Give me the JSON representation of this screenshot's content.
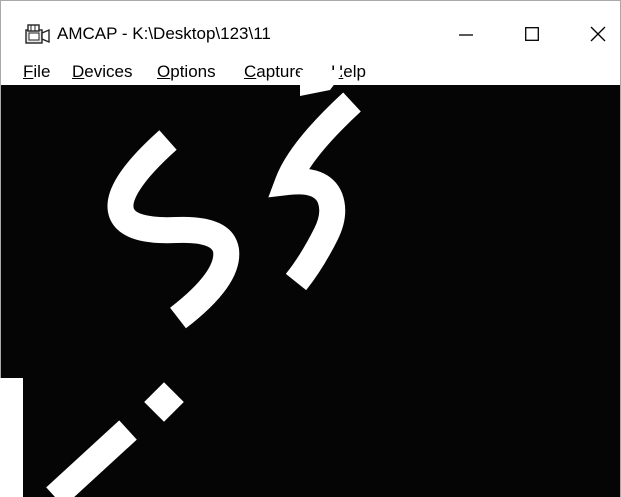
{
  "window": {
    "title": "AMCAP - K:\\Desktop\\123\\11",
    "icons": {
      "app": "camera-app-icon",
      "minimize": "minimize-icon",
      "maximize": "maximize-icon",
      "close": "close-icon"
    }
  },
  "menubar": {
    "items": [
      {
        "accel": "F",
        "rest": "ile"
      },
      {
        "accel": "D",
        "rest": "evices"
      },
      {
        "accel": "O",
        "rest": "ptions"
      },
      {
        "accel": "C",
        "rest": "apture"
      },
      {
        "accel": "H",
        "rest": "elp"
      }
    ]
  },
  "preview": {
    "background": "#050505"
  },
  "colors": {
    "watermark": "#ffffff",
    "border": "#a9a9a9"
  }
}
